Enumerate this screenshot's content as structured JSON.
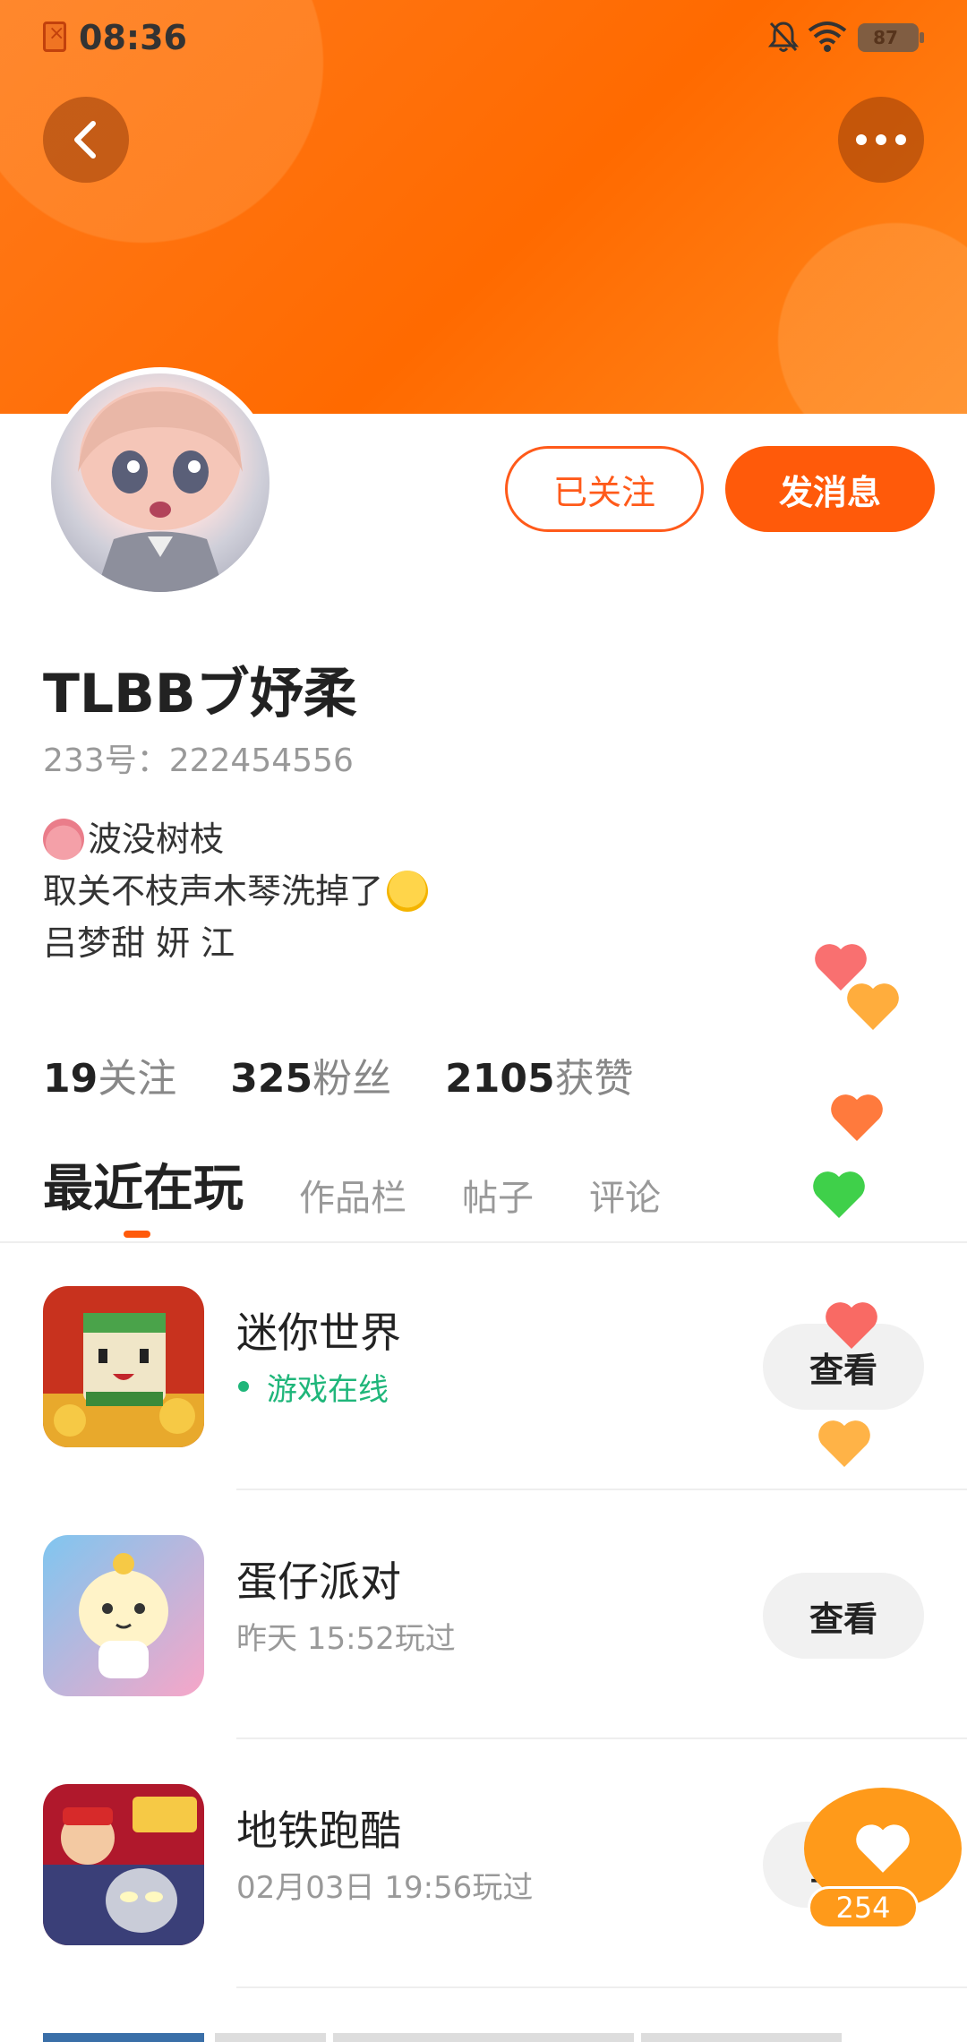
{
  "status_bar": {
    "time": "08:36",
    "battery": "87"
  },
  "profile": {
    "follow_button": "已关注",
    "message_button": "发消息",
    "username": "TLBBブ妤柔",
    "user_id": "233号：222454556",
    "bio_lines": [
      "波没树枝",
      "取关不枝声木琴洗掉了",
      "吕梦甜 妍 江"
    ]
  },
  "stats": [
    {
      "value": "19",
      "label": "关注"
    },
    {
      "value": "325",
      "label": "粉丝"
    },
    {
      "value": "2105",
      "label": "获赞"
    }
  ],
  "tabs": [
    "最近在玩",
    "作品栏",
    "帖子",
    "评论"
  ],
  "games": [
    {
      "name": "迷你世界",
      "status": "游戏在线",
      "online": true,
      "action": "查看"
    },
    {
      "name": "蛋仔派对",
      "status": "昨天 15:52玩过",
      "online": false,
      "action": "查看"
    },
    {
      "name": "地铁跑酷",
      "status": "02月03日 19:56玩过",
      "online": false,
      "action": "查看"
    }
  ],
  "like_fab": {
    "count": "254"
  },
  "colors": {
    "accent": "#ff5a0a",
    "online": "#1fb67a",
    "like": "#ff9a1a"
  }
}
